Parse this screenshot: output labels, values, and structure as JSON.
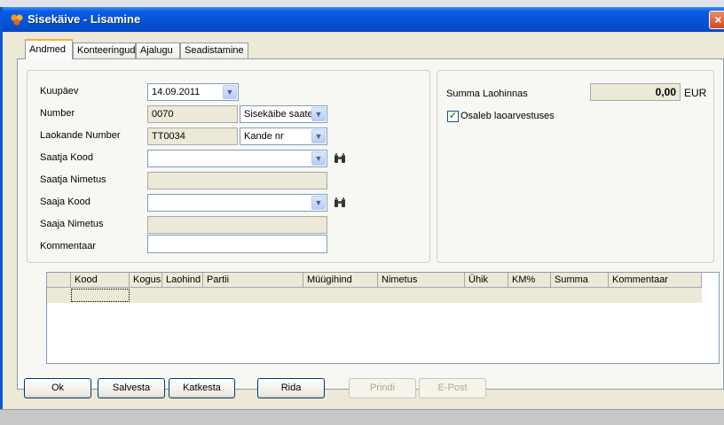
{
  "window": {
    "title": "Sisekäive - Lisamine",
    "close_label": "×"
  },
  "tabs": [
    {
      "label": "Andmed"
    },
    {
      "label": "Konteeringud"
    },
    {
      "label": "Ajalugu"
    },
    {
      "label": "Seadistamine"
    }
  ],
  "form": {
    "kuupaev": {
      "label": "Kuupäev",
      "value": "14.09.2011"
    },
    "number": {
      "label": "Number",
      "value": "0070",
      "type_value": "Sisekäibe saate"
    },
    "laokande": {
      "label": "Laokande Number",
      "value": "TT0034",
      "type_value": "Kande nr"
    },
    "saatja_kood": {
      "label": "Saatja Kood",
      "value": ""
    },
    "saatja_nimetus": {
      "label": "Saatja Nimetus",
      "value": ""
    },
    "saaja_kood": {
      "label": "Saaja Kood",
      "value": ""
    },
    "saaja_nimetus": {
      "label": "Saaja Nimetus",
      "value": ""
    },
    "kommentaar": {
      "label": "Kommentaar",
      "value": ""
    }
  },
  "summary": {
    "summa_label": "Summa Laohinnas",
    "summa_value": "0,00",
    "currency": "EUR",
    "checkbox_label": "Osaleb laoarvestuses",
    "checkbox_checked": true
  },
  "grid": {
    "columns": [
      "Kood",
      "Kogus",
      "Laohind",
      "Partii",
      "Müügihind",
      "Nimetus",
      "Ühik",
      "KM%",
      "Summa",
      "Kommentaar"
    ]
  },
  "buttons": {
    "ok": "Ok",
    "salvesta": "Salvesta",
    "katkesta": "Katkesta",
    "rida": "Rida",
    "prindi": "Prindi",
    "epost": "E-Post"
  },
  "colors": {
    "titlebar": "#0554d8",
    "window_bg": "#ece9d8",
    "input_border": "#7f9db9"
  }
}
